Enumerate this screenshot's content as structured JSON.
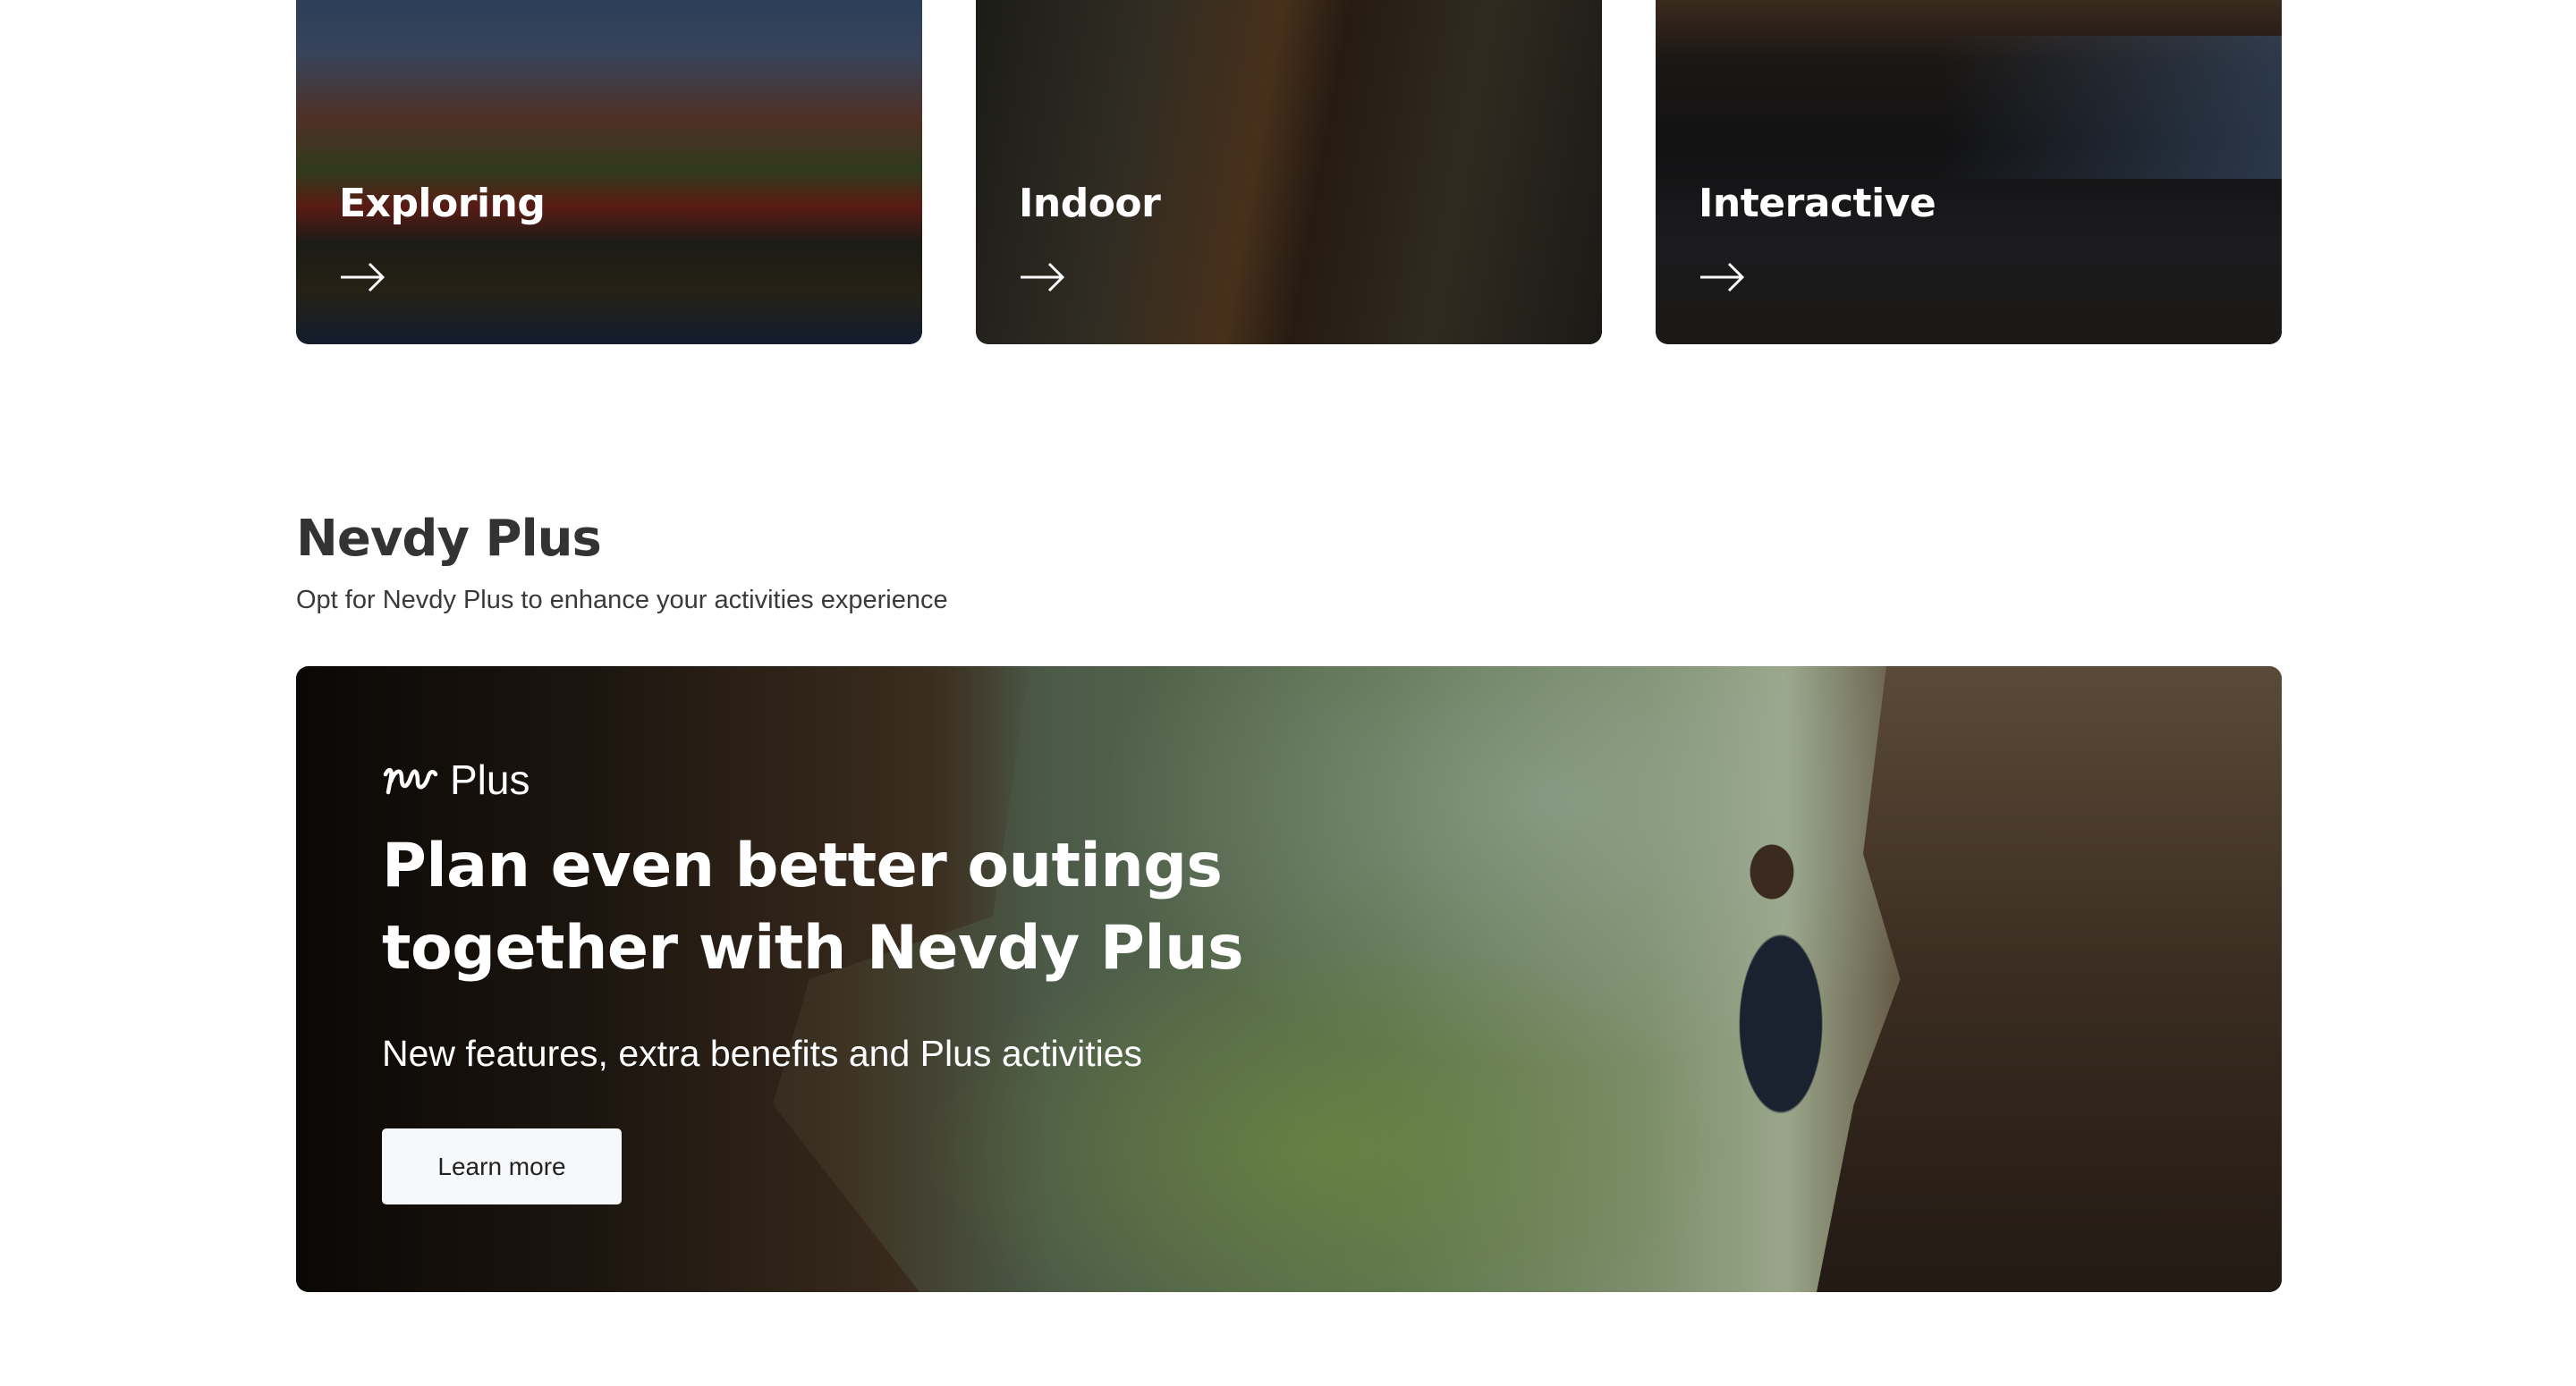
{
  "categories": [
    {
      "label": "Exploring",
      "icon": "arrow-right-icon"
    },
    {
      "label": "Indoor",
      "icon": "arrow-right-icon"
    },
    {
      "label": "Interactive",
      "icon": "arrow-right-icon"
    }
  ],
  "plus_section": {
    "title": "Nevdy Plus",
    "subtitle": "Opt for Nevdy Plus to enhance your activities experience",
    "banner": {
      "logo_text": "Plus",
      "headline_line1": "Plan even better outings",
      "headline_line2": "together with Nevdy Plus",
      "description": "New features, extra benefits and Plus activities",
      "button_label": "Learn more"
    }
  }
}
